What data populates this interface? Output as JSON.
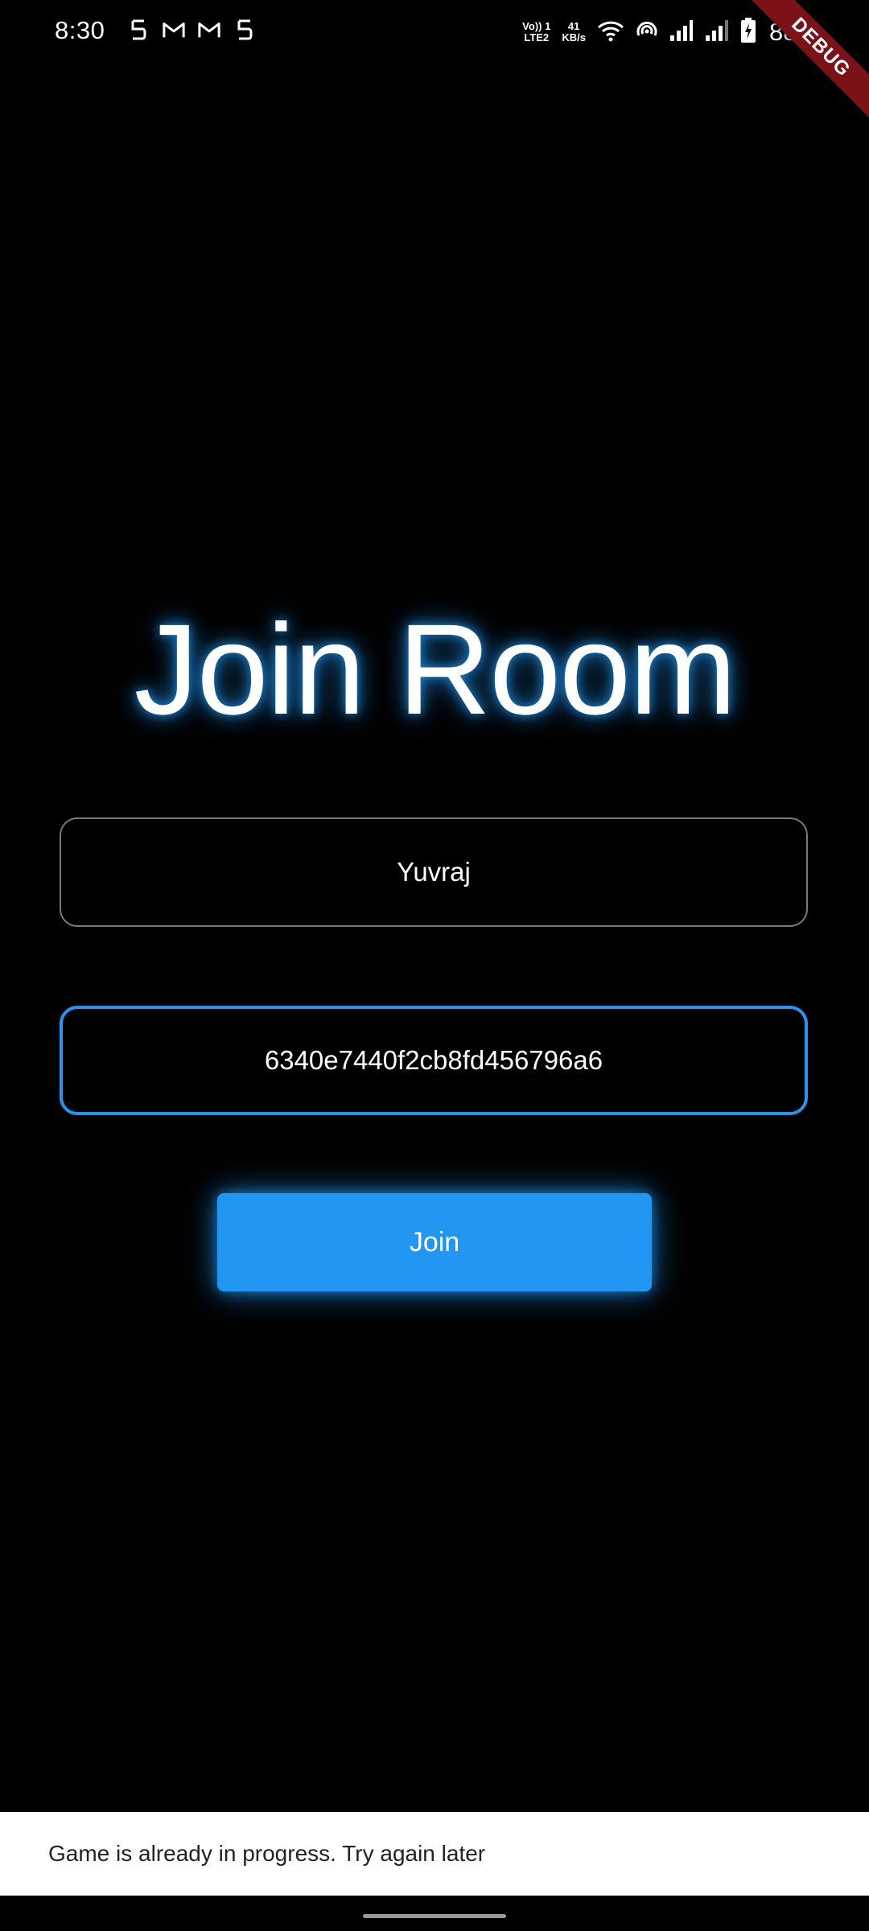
{
  "status_bar": {
    "time": "8:30",
    "net_top": "Vo)) 1",
    "net_bottom": "LTE2",
    "speed_value": "41",
    "speed_unit": "KB/s",
    "battery": "88%",
    "notification_icons": [
      "s-icon",
      "gmail-icon",
      "gmail-icon",
      "s-icon"
    ],
    "system_icons": [
      "wifi-icon",
      "hotspot-icon",
      "signal-1-icon",
      "signal-2-icon",
      "battery-charging-icon"
    ]
  },
  "debug_banner": "DEBUG",
  "title": "Join Room",
  "form": {
    "name_value": "Yuvraj",
    "room_id_value": "6340e7440f2cb8fd456796a6",
    "join_label": "Join"
  },
  "snackbar": {
    "message": "Game is already in progress. Try again later"
  },
  "colors": {
    "background": "#000000",
    "accent": "#2196f3",
    "snackbar_bg": "#ffffff",
    "debug_ribbon": "#7a1218"
  }
}
